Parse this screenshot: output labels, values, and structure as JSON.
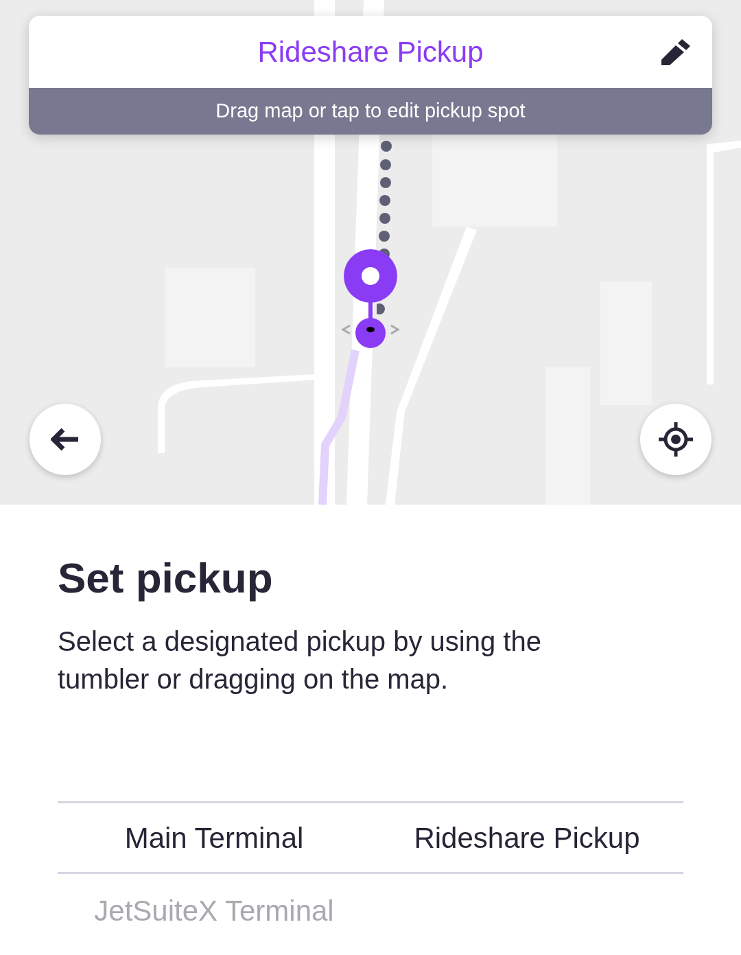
{
  "header": {
    "title": "Rideshare Pickup",
    "hint": "Drag map or tap to edit pickup spot"
  },
  "sheet": {
    "title": "Set pickup",
    "description": "Select a designated pickup by using the tumbler or dragging on the map."
  },
  "tumbler": {
    "columns": [
      {
        "options": [
          {
            "label": "Main Terminal",
            "selected": true
          },
          {
            "label": "JetSuiteX Terminal",
            "selected": false
          }
        ]
      },
      {
        "options": [
          {
            "label": "Rideshare Pickup",
            "selected": true
          }
        ]
      }
    ]
  }
}
